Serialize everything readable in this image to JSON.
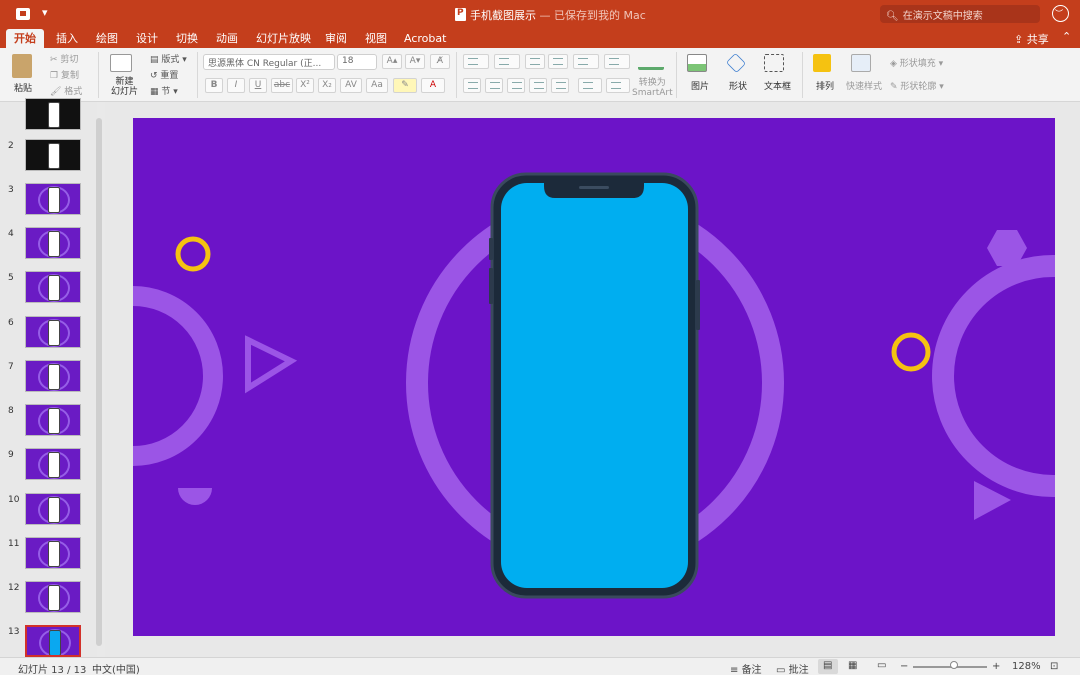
{
  "titlebar": {
    "title": "手机截图展示",
    "subtitle": " — 已保存到我的 Mac",
    "search_placeholder": "在演示文稿中搜索"
  },
  "tabs": [
    "开始",
    "插入",
    "绘图",
    "设计",
    "切换",
    "动画",
    "幻灯片放映",
    "审阅",
    "视图",
    "Acrobat"
  ],
  "active_tab": "开始",
  "share_label": "共享",
  "ribbon": {
    "paste": "粘贴",
    "cut": "剪切",
    "copy": "复制",
    "format_painter": "格式",
    "new_slide_line1": "新建",
    "new_slide_line2": "幻灯片",
    "layout": "版式",
    "reset": "重置",
    "section": "节",
    "font_name": "思源黑体 CN Regular (正...",
    "font_size": "18",
    "convert_smartart_line1": "转换为",
    "convert_smartart_line2": "SmartArt",
    "picture": "图片",
    "shapes": "形状",
    "textbox": "文本框",
    "arrange": "排列",
    "quick_styles": "快速样式",
    "shape_fill": "形状填充",
    "shape_outline": "形状轮廓"
  },
  "slides": [
    {
      "num": "",
      "style": "dark"
    },
    {
      "num": "2",
      "style": "dark"
    },
    {
      "num": "3",
      "style": "purple"
    },
    {
      "num": "4",
      "style": "purple"
    },
    {
      "num": "5",
      "style": "purple"
    },
    {
      "num": "6",
      "style": "purple"
    },
    {
      "num": "7",
      "style": "purple"
    },
    {
      "num": "8",
      "style": "purple"
    },
    {
      "num": "9",
      "style": "purple"
    },
    {
      "num": "10",
      "style": "purple"
    },
    {
      "num": "11",
      "style": "purple"
    },
    {
      "num": "12",
      "style": "purple"
    },
    {
      "num": "13",
      "style": "purple-selected"
    }
  ],
  "status": {
    "slide_counter": "幻灯片 13 / 13",
    "language": "中文(中国)",
    "notes": "备注",
    "comments": "批注",
    "zoom": "128%"
  },
  "colors": {
    "brand": "#c43e1c",
    "slide_bg": "#6c14c8",
    "screen": "#00aef0",
    "accent_yellow": "#f5c211"
  }
}
